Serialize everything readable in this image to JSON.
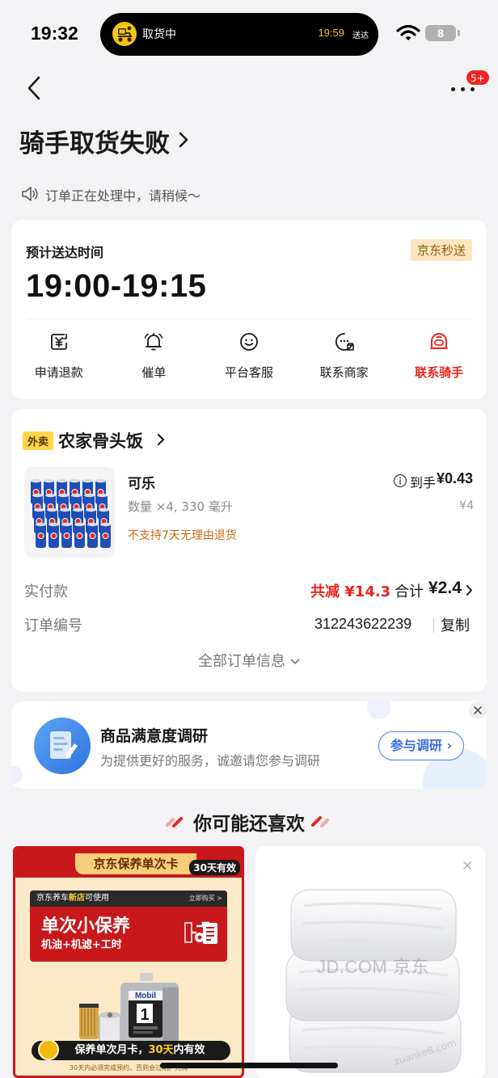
{
  "status_bar": {
    "time": "19:32",
    "island_label": "取货中",
    "island_time": "19:59",
    "island_suffix": "送达",
    "battery": "8"
  },
  "nav": {
    "badge": "5+"
  },
  "page": {
    "title": "骑手取货失败",
    "notice": "订单正在处理中，请稍候～"
  },
  "delivery": {
    "eta_label": "预计送达时间",
    "tag": "京东秒送",
    "eta_time": "19:00-19:15",
    "actions": [
      {
        "label": "申请退款",
        "icon": "refund-icon"
      },
      {
        "label": "催单",
        "icon": "bell-icon"
      },
      {
        "label": "平台客服",
        "icon": "smile-icon"
      },
      {
        "label": "联系商家",
        "icon": "store-chat-icon"
      },
      {
        "label": "联系骑手",
        "icon": "rider-icon"
      }
    ],
    "accent_color": "#e8261f"
  },
  "order": {
    "tag": "外卖",
    "shop_name": "农家骨头饭",
    "product": {
      "name": "可乐",
      "spec": "数量 ×4, 330 毫升",
      "warning": "不支持7天无理由退货",
      "net_label": "到手",
      "net_price": "¥0.43",
      "orig_price": "¥4"
    },
    "paid_label": "实付款",
    "discount": "共减 ¥14.3",
    "total_label": "合计",
    "total_value": "¥2.4",
    "order_no_label": "订单编号",
    "order_no": "312243622239",
    "copy_label": "复制",
    "all_info": "全部订单信息"
  },
  "survey": {
    "title": "商品满意度调研",
    "subtitle": "为提供更好的服务，诚邀请您参与调研",
    "button": "参与调研 ›"
  },
  "recommend": {
    "title": "你可能还喜欢",
    "card1": {
      "tab": "京东保养单次卡",
      "valid": "30天有效",
      "shop_pre": "京东养车",
      "shop_hl": "新店",
      "shop_post": "可使用",
      "buy": "立即购买 >",
      "headline": "单次小保养",
      "sub": "机油+机滤+工时",
      "brand": "Mobil 1",
      "promo_pre": "保养单次月卡，",
      "promo_hl": "30天",
      "promo_post": "内有效",
      "footer": "30天内必须完成预约，否则会过期。先购"
    },
    "card2": {
      "watermark": "JD.COM 京东",
      "watermark2": "zuanke8.com"
    }
  }
}
